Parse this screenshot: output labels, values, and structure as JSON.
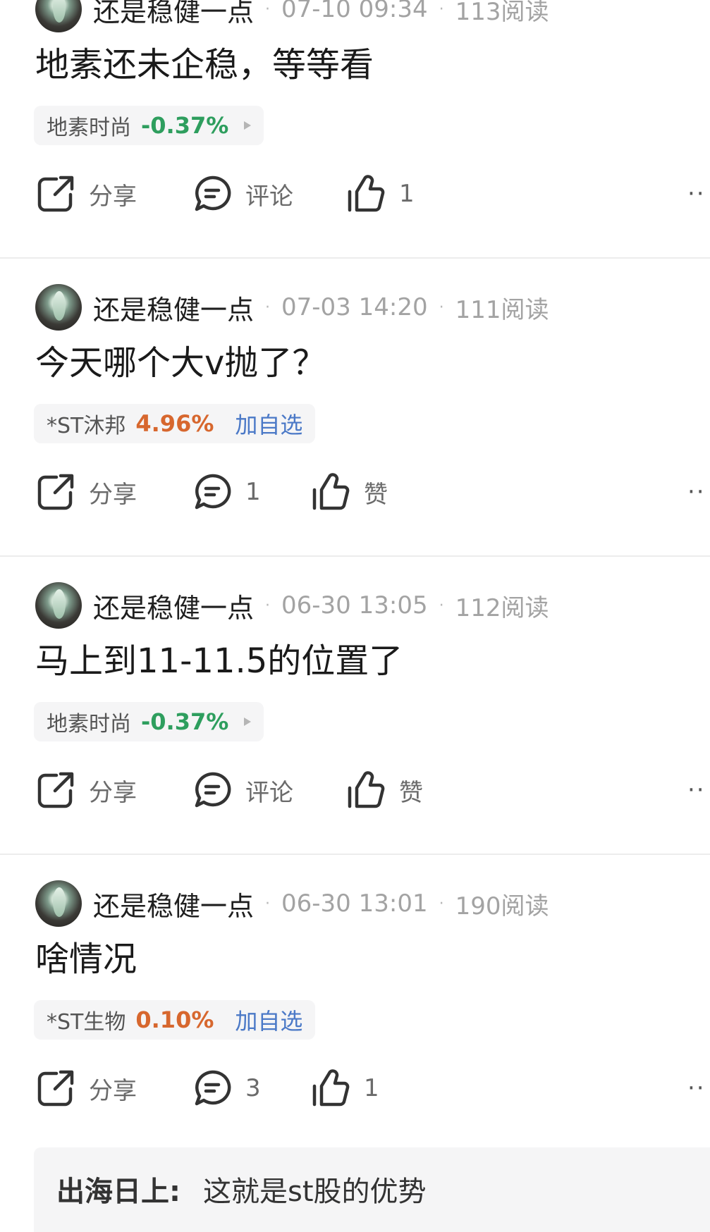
{
  "posts": [
    {
      "author": "还是稳健一点",
      "time": "07-10 09:34",
      "reads": "113阅读",
      "text": "地素还未企稳，等等看",
      "stock": {
        "name": "地素时尚",
        "change": "-0.37%",
        "direction": "down"
      },
      "share_label": "分享",
      "comment_label": "评论",
      "like_label": "1"
    },
    {
      "author": "还是稳健一点",
      "time": "07-03 14:20",
      "reads": "111阅读",
      "text": "今天哪个大v抛了？",
      "stock": {
        "name": "*ST沐邦",
        "change": "4.96%",
        "direction": "up",
        "add_label": "加自选"
      },
      "share_label": "分享",
      "comment_label": "1",
      "like_label": "赞"
    },
    {
      "author": "还是稳健一点",
      "time": "06-30 13:05",
      "reads": "112阅读",
      "text": "马上到11-11.5的位置了",
      "stock": {
        "name": "地素时尚",
        "change": "-0.37%",
        "direction": "down"
      },
      "share_label": "分享",
      "comment_label": "评论",
      "like_label": "赞"
    },
    {
      "author": "还是稳健一点",
      "time": "06-30 13:01",
      "reads": "190阅读",
      "text": "啥情况",
      "stock": {
        "name": "*ST生物",
        "change": "0.10%",
        "direction": "up",
        "add_label": "加自选"
      },
      "share_label": "分享",
      "comment_label": "3",
      "like_label": "1"
    }
  ],
  "comment_preview": {
    "author": "出海日上:",
    "text": "这就是st股的优势"
  },
  "separator": "·",
  "more_label": "··",
  "colors": {
    "down": "#2e9e5e",
    "up": "#d7672e",
    "link": "#4b79c7",
    "meta": "#a3a3a3",
    "tag_bg": "#f5f5f6"
  }
}
